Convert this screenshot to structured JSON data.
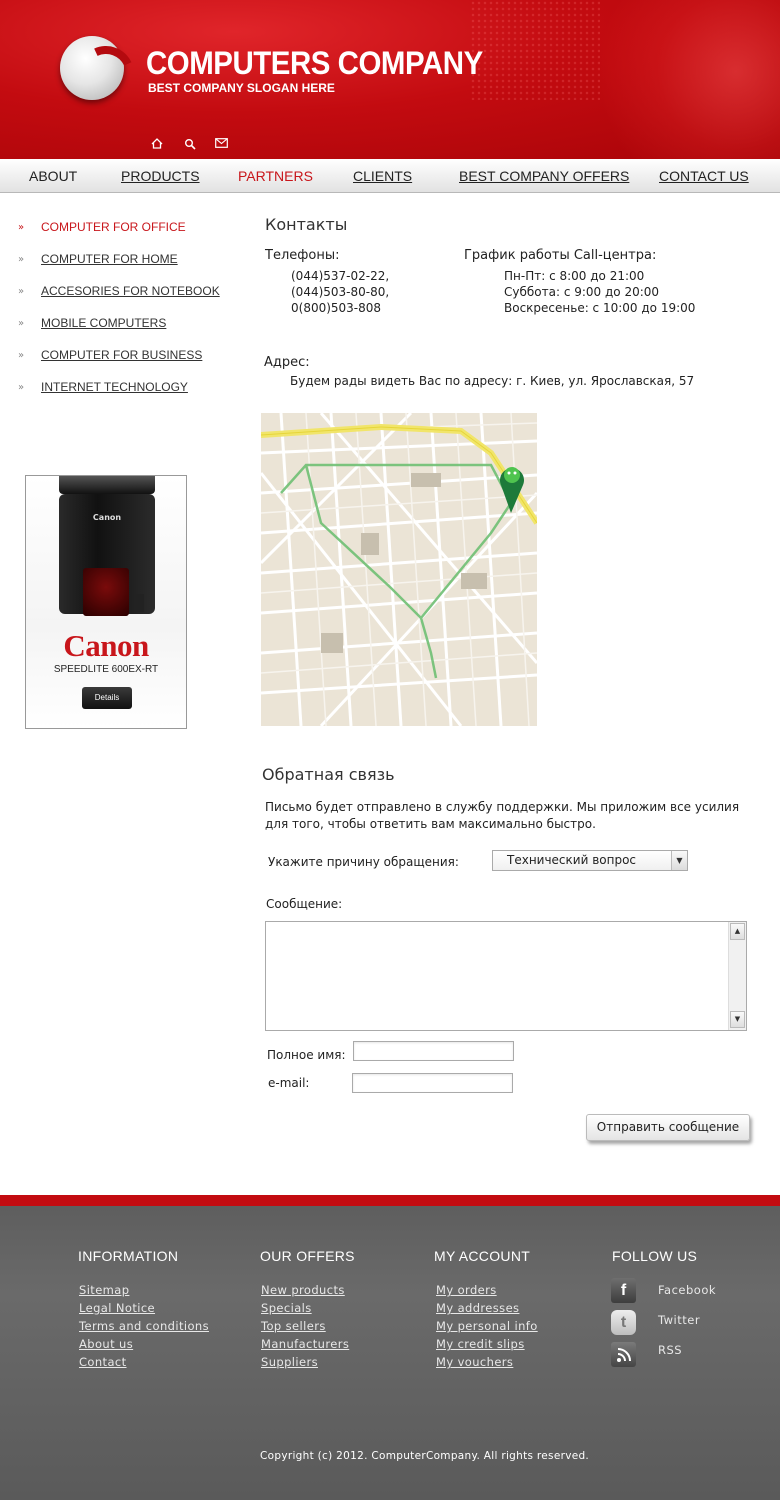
{
  "brand": {
    "name": "COMPUTERS COMPANY",
    "slogan": "BEST COMPANY SLOGAN HERE"
  },
  "header_icons": [
    "home-icon",
    "search-icon",
    "mail-icon"
  ],
  "nav": [
    "ABOUT",
    "PRODUCTS",
    "PARTNERS",
    "CLIENTS",
    "BEST COMPANY OFFERS",
    "CONTACT US"
  ],
  "nav_active": "PARTNERS",
  "sidebar": [
    "COMPUTER FOR OFFICE",
    "COMPUTER FOR HOME",
    "ACCESORIES FOR NOTEBOOK",
    "MOBILE COMPUTERS",
    "COMPUTER FOR BUSINESS",
    "INTERNET TECHNOLOGY"
  ],
  "sidebar_active": "COMPUTER FOR OFFICE",
  "ad": {
    "flash_brand": "Canon",
    "brand": "Canon",
    "model": "SPEEDLITE 600EX-RT",
    "button": "Details"
  },
  "contacts": {
    "title": "Контакты",
    "phones_label": "Телефоны:",
    "phones": [
      "(044)537-02-22,",
      "(044)503-80-80,",
      "0(800)503-808"
    ],
    "schedule_label": "График работы Call-центра:",
    "schedule": [
      "Пн-Пт: с 8:00 до 21:00",
      "Суббота: с 9:00 до 20:00",
      "Воскресенье: с 10:00 до 19:00"
    ],
    "address_label": "Адрес:",
    "address": "Будем рады видеть Вас по адресу: г. Киев, ул. Ярославская, 57"
  },
  "feedback": {
    "title": "Обратная связь",
    "intro1": "Письмо будет отправлено в службу поддержки. Мы приложим все усилия",
    "intro2": "для того, чтобы ответить вам максимально быстро.",
    "reason_label": "Укажите причину обращения:",
    "reason_value": "Технический вопрос",
    "message_label": "Сообщение:",
    "message_value": "",
    "name_label": "Полное имя:",
    "name_value": "",
    "email_label": "e-mail:",
    "email_value": "",
    "submit": "Отправить сообщение"
  },
  "footer": {
    "information": {
      "title": "INFORMATION",
      "links": [
        "Sitemap",
        "Legal Notice",
        "Terms and conditions",
        "About us",
        "Contact"
      ]
    },
    "offers": {
      "title": "OUR OFFERS",
      "links": [
        "New products",
        "Specials",
        "Top sellers",
        "Manufacturers",
        "Suppliers"
      ]
    },
    "account": {
      "title": "MY ACCOUNT",
      "links": [
        "My orders",
        "My addresses",
        "My personal info",
        "My credit slips",
        "My vouchers"
      ]
    },
    "follow": {
      "title": "FOLLOW US",
      "items": [
        {
          "label": "Facebook",
          "icon": "facebook-icon"
        },
        {
          "label": "Twitter",
          "icon": "twitter-icon"
        },
        {
          "label": "RSS",
          "icon": "rss-icon"
        }
      ]
    },
    "copyright": "Copyright (c) 2012. ComputerCompany. All rights reserved."
  },
  "colors": {
    "brand_red": "#c30b10",
    "active_red": "#c8161b",
    "footer_gray": "#5e5e5e"
  }
}
